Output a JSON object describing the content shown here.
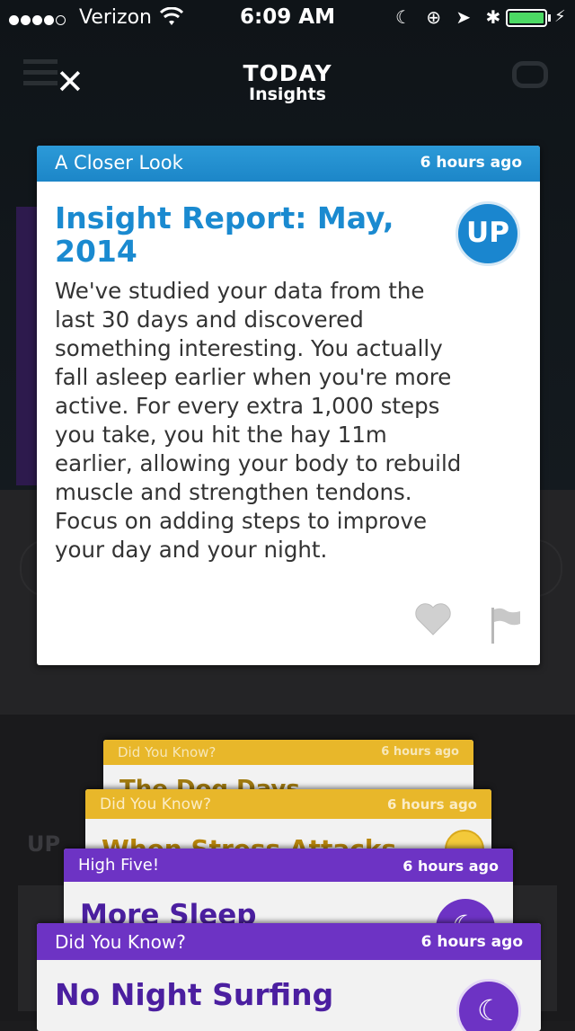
{
  "status_bar": {
    "carrier": "Verizon",
    "time": "6:09 AM",
    "battery_color": "#4cd964"
  },
  "header": {
    "title": "TODAY",
    "subtitle": "Insights",
    "close_icon": "close-icon"
  },
  "main_card": {
    "category": "A Closer Look",
    "time": "6 hours ago",
    "title": "Insight Report: May, 2014",
    "badge": "UP",
    "body": "We've studied your data from the last 30 days and discovered something interesting. You actually fall asleep earlier when you're more active. For every extra 1,000 steps you take, you hit the hay 11m earlier, allowing your body to rebuild muscle and strengthen tendons. Focus on adding steps to improve your day and your night.",
    "accent": "#1a8ad0"
  },
  "stacked_cards": [
    {
      "category": "Did You Know?",
      "time": "6 hours ago",
      "title": "The Dog Days",
      "color": "#e8b72a"
    },
    {
      "category": "Did You Know?",
      "time": "6 hours ago",
      "title": "When Stress Attacks",
      "color": "#e8b72a"
    },
    {
      "category": "High Five!",
      "time": "6 hours ago",
      "title": "More Sleep",
      "color": "#6d33c4"
    },
    {
      "category": "Did You Know?",
      "time": "6 hours ago",
      "title": "No Night Surfing",
      "color": "#6d33c4"
    }
  ]
}
